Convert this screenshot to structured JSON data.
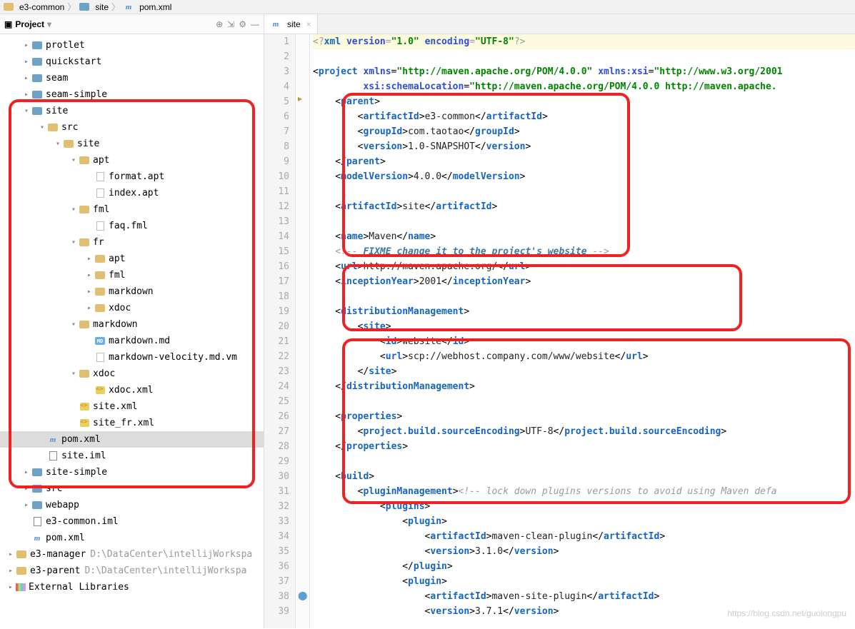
{
  "breadcrumb": [
    {
      "icon": "folder-pkg",
      "text": "e3-common"
    },
    {
      "icon": "folder-blue",
      "text": "site"
    },
    {
      "icon": "maven",
      "text": "pom.xml"
    }
  ],
  "sidebar": {
    "title": "Project",
    "tree": [
      {
        "label": "protlet",
        "icon": "folder-blue",
        "arrow": "right",
        "depth": 1
      },
      {
        "label": "quickstart",
        "icon": "folder-blue",
        "arrow": "right",
        "depth": 1
      },
      {
        "label": "seam",
        "icon": "folder-blue",
        "arrow": "right",
        "depth": 1
      },
      {
        "label": "seam-simple",
        "icon": "folder-blue",
        "arrow": "right",
        "depth": 1
      },
      {
        "label": "site",
        "icon": "folder-blue",
        "arrow": "down",
        "depth": 1
      },
      {
        "label": "src",
        "icon": "folder",
        "arrow": "down",
        "depth": 2
      },
      {
        "label": "site",
        "icon": "folder",
        "arrow": "down",
        "depth": 3
      },
      {
        "label": "apt",
        "icon": "folder",
        "arrow": "down",
        "depth": 4
      },
      {
        "label": "format.apt",
        "icon": "file",
        "arrow": "none",
        "depth": 5
      },
      {
        "label": "index.apt",
        "icon": "file",
        "arrow": "none",
        "depth": 5
      },
      {
        "label": "fml",
        "icon": "folder",
        "arrow": "down",
        "depth": 4
      },
      {
        "label": "faq.fml",
        "icon": "file",
        "arrow": "none",
        "depth": 5
      },
      {
        "label": "fr",
        "icon": "folder",
        "arrow": "down",
        "depth": 4
      },
      {
        "label": "apt",
        "icon": "folder",
        "arrow": "right",
        "depth": 5
      },
      {
        "label": "fml",
        "icon": "folder",
        "arrow": "right",
        "depth": 5
      },
      {
        "label": "markdown",
        "icon": "folder",
        "arrow": "right",
        "depth": 5
      },
      {
        "label": "xdoc",
        "icon": "folder",
        "arrow": "right",
        "depth": 5
      },
      {
        "label": "markdown",
        "icon": "folder",
        "arrow": "down",
        "depth": 4
      },
      {
        "label": "markdown.md",
        "icon": "md",
        "arrow": "none",
        "depth": 5
      },
      {
        "label": "markdown-velocity.md.vm",
        "icon": "file-h",
        "arrow": "none",
        "depth": 5
      },
      {
        "label": "xdoc",
        "icon": "folder",
        "arrow": "down",
        "depth": 4
      },
      {
        "label": "xdoc.xml",
        "icon": "xml",
        "arrow": "none",
        "depth": 5
      },
      {
        "label": "site.xml",
        "icon": "xml",
        "arrow": "none",
        "depth": 4
      },
      {
        "label": "site_fr.xml",
        "icon": "xml",
        "arrow": "none",
        "depth": 4
      },
      {
        "label": "pom.xml",
        "icon": "maven",
        "arrow": "none",
        "depth": 2,
        "selected": true
      },
      {
        "label": "site.iml",
        "icon": "iml",
        "arrow": "none",
        "depth": 2
      },
      {
        "label": "site-simple",
        "icon": "folder-blue",
        "arrow": "right",
        "depth": 1
      },
      {
        "label": "src",
        "icon": "folder-blue",
        "arrow": "right",
        "depth": 1
      },
      {
        "label": "webapp",
        "icon": "folder-blue",
        "arrow": "right",
        "depth": 1
      },
      {
        "label": "e3-common.iml",
        "icon": "iml",
        "arrow": "none",
        "depth": 1
      },
      {
        "label": "pom.xml",
        "icon": "maven",
        "arrow": "none",
        "depth": 1
      },
      {
        "label": "e3-manager",
        "icon": "folder-pkg",
        "arrow": "right",
        "depth": 0,
        "hint": "D:\\DataCenter\\intellijWorkspa"
      },
      {
        "label": "e3-parent",
        "icon": "folder-pkg",
        "arrow": "right",
        "depth": 0,
        "hint": "D:\\DataCenter\\intellijWorkspa"
      },
      {
        "label": "External Libraries",
        "icon": "lib",
        "arrow": "right",
        "depth": 0
      }
    ]
  },
  "editor": {
    "tab": {
      "icon": "maven",
      "label": "site"
    },
    "line_start": 1,
    "line_end": 39,
    "caret_pos_line": 1
  },
  "code": {
    "xml_decl": {
      "version": "1.0",
      "encoding": "UTF-8"
    },
    "project_attrs": {
      "xmlns": "http://maven.apache.org/POM/4.0.0",
      "xmlns_xsi": "http://www.w3.org/2001",
      "schemaLocation": "http://maven.apache.org/POM/4.0.0 http://maven.apache."
    },
    "parent": {
      "artifactId": "e3-common",
      "groupId": "com.taotao",
      "version": "1.0-SNAPSHOT"
    },
    "modelVersion": "4.0.0",
    "artifactId": "site",
    "name": "Maven",
    "url_comment": "FIXME change it to the project's website",
    "url": "http://maven.apache.org/",
    "inceptionYear": "2001",
    "dist": {
      "site_id": "website",
      "site_url": "scp://webhost.company.com/www/website"
    },
    "props": {
      "encoding_key": "project.build.sourceEncoding",
      "encoding_val": "UTF-8"
    },
    "build_comment": "lock down plugins versions to avoid using Maven defa",
    "plugins": [
      {
        "artifactId": "maven-clean-plugin",
        "version": "3.1.0"
      },
      {
        "artifactId": "maven-site-plugin",
        "version": "3.7.1"
      }
    ]
  },
  "watermark": "https://blog.csdn.net/guolongpu"
}
